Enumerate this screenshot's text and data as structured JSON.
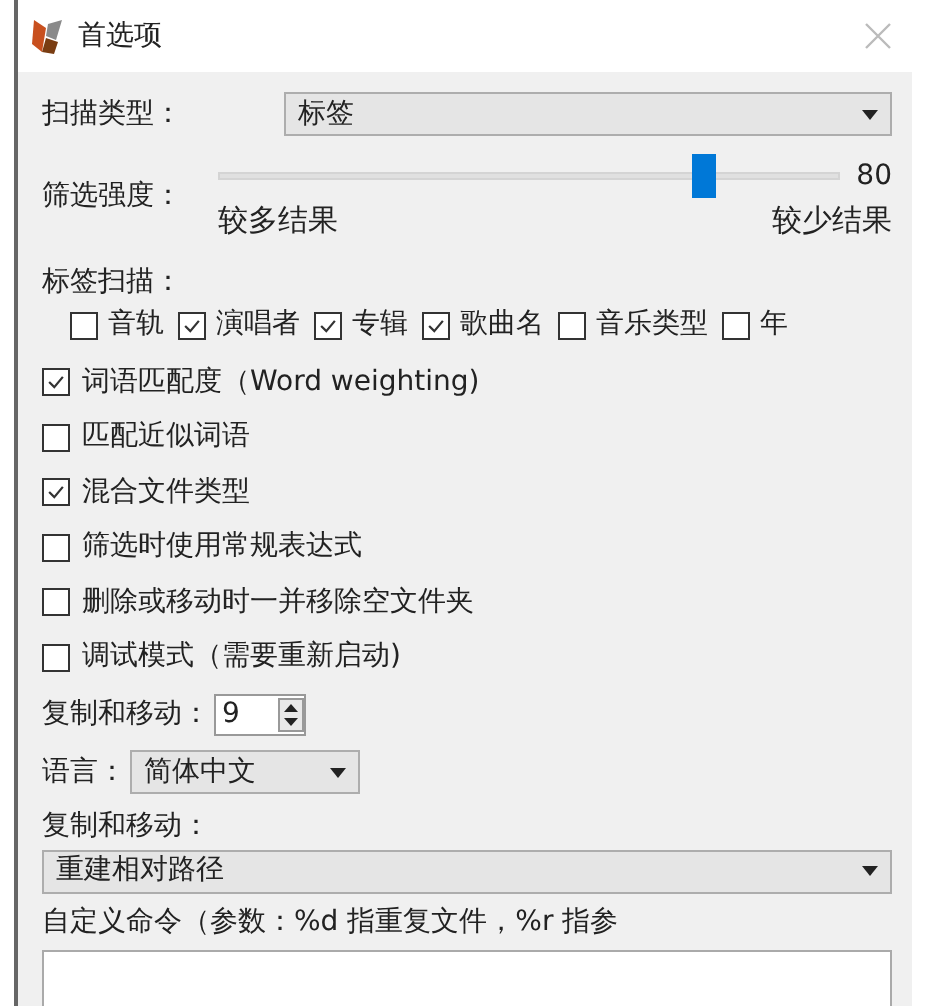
{
  "window": {
    "title": "首选项"
  },
  "scan_type": {
    "label": "扫描类型：",
    "value": "标签"
  },
  "filter_strength": {
    "label": "筛选强度：",
    "level": 0.78,
    "reading": "80",
    "min_label": "较多结果",
    "max_label": "较少结果"
  },
  "tag_scan": {
    "label": "标签扫描：",
    "fields": [
      {
        "label": "音轨",
        "checked": false
      },
      {
        "label": "演唱者",
        "checked": true
      },
      {
        "label": "专辑",
        "checked": true
      },
      {
        "label": "歌曲名",
        "checked": true
      },
      {
        "label": "音乐类型",
        "checked": false
      },
      {
        "label": "年",
        "checked": false
      }
    ]
  },
  "options": [
    {
      "label": "词语匹配度（Word weighting)",
      "checked": true
    },
    {
      "label": "匹配近似词语",
      "checked": false
    },
    {
      "label": "混合文件类型",
      "checked": true
    },
    {
      "label": "筛选时使用常规表达式",
      "checked": false
    },
    {
      "label": "删除或移动时一并移除空文件夹",
      "checked": false
    },
    {
      "label": "调试模式（需要重新启动)",
      "checked": false
    }
  ],
  "copy_move_count": {
    "label": "复制和移动：",
    "value": "9"
  },
  "language": {
    "label": "语言：",
    "value": "简体中文"
  },
  "copy_move": {
    "label": "复制和移动：",
    "value": "重建相对路径"
  },
  "custom_command": {
    "label": "自定义命令（参数：%d 指重复文件，%r 指参"
  }
}
